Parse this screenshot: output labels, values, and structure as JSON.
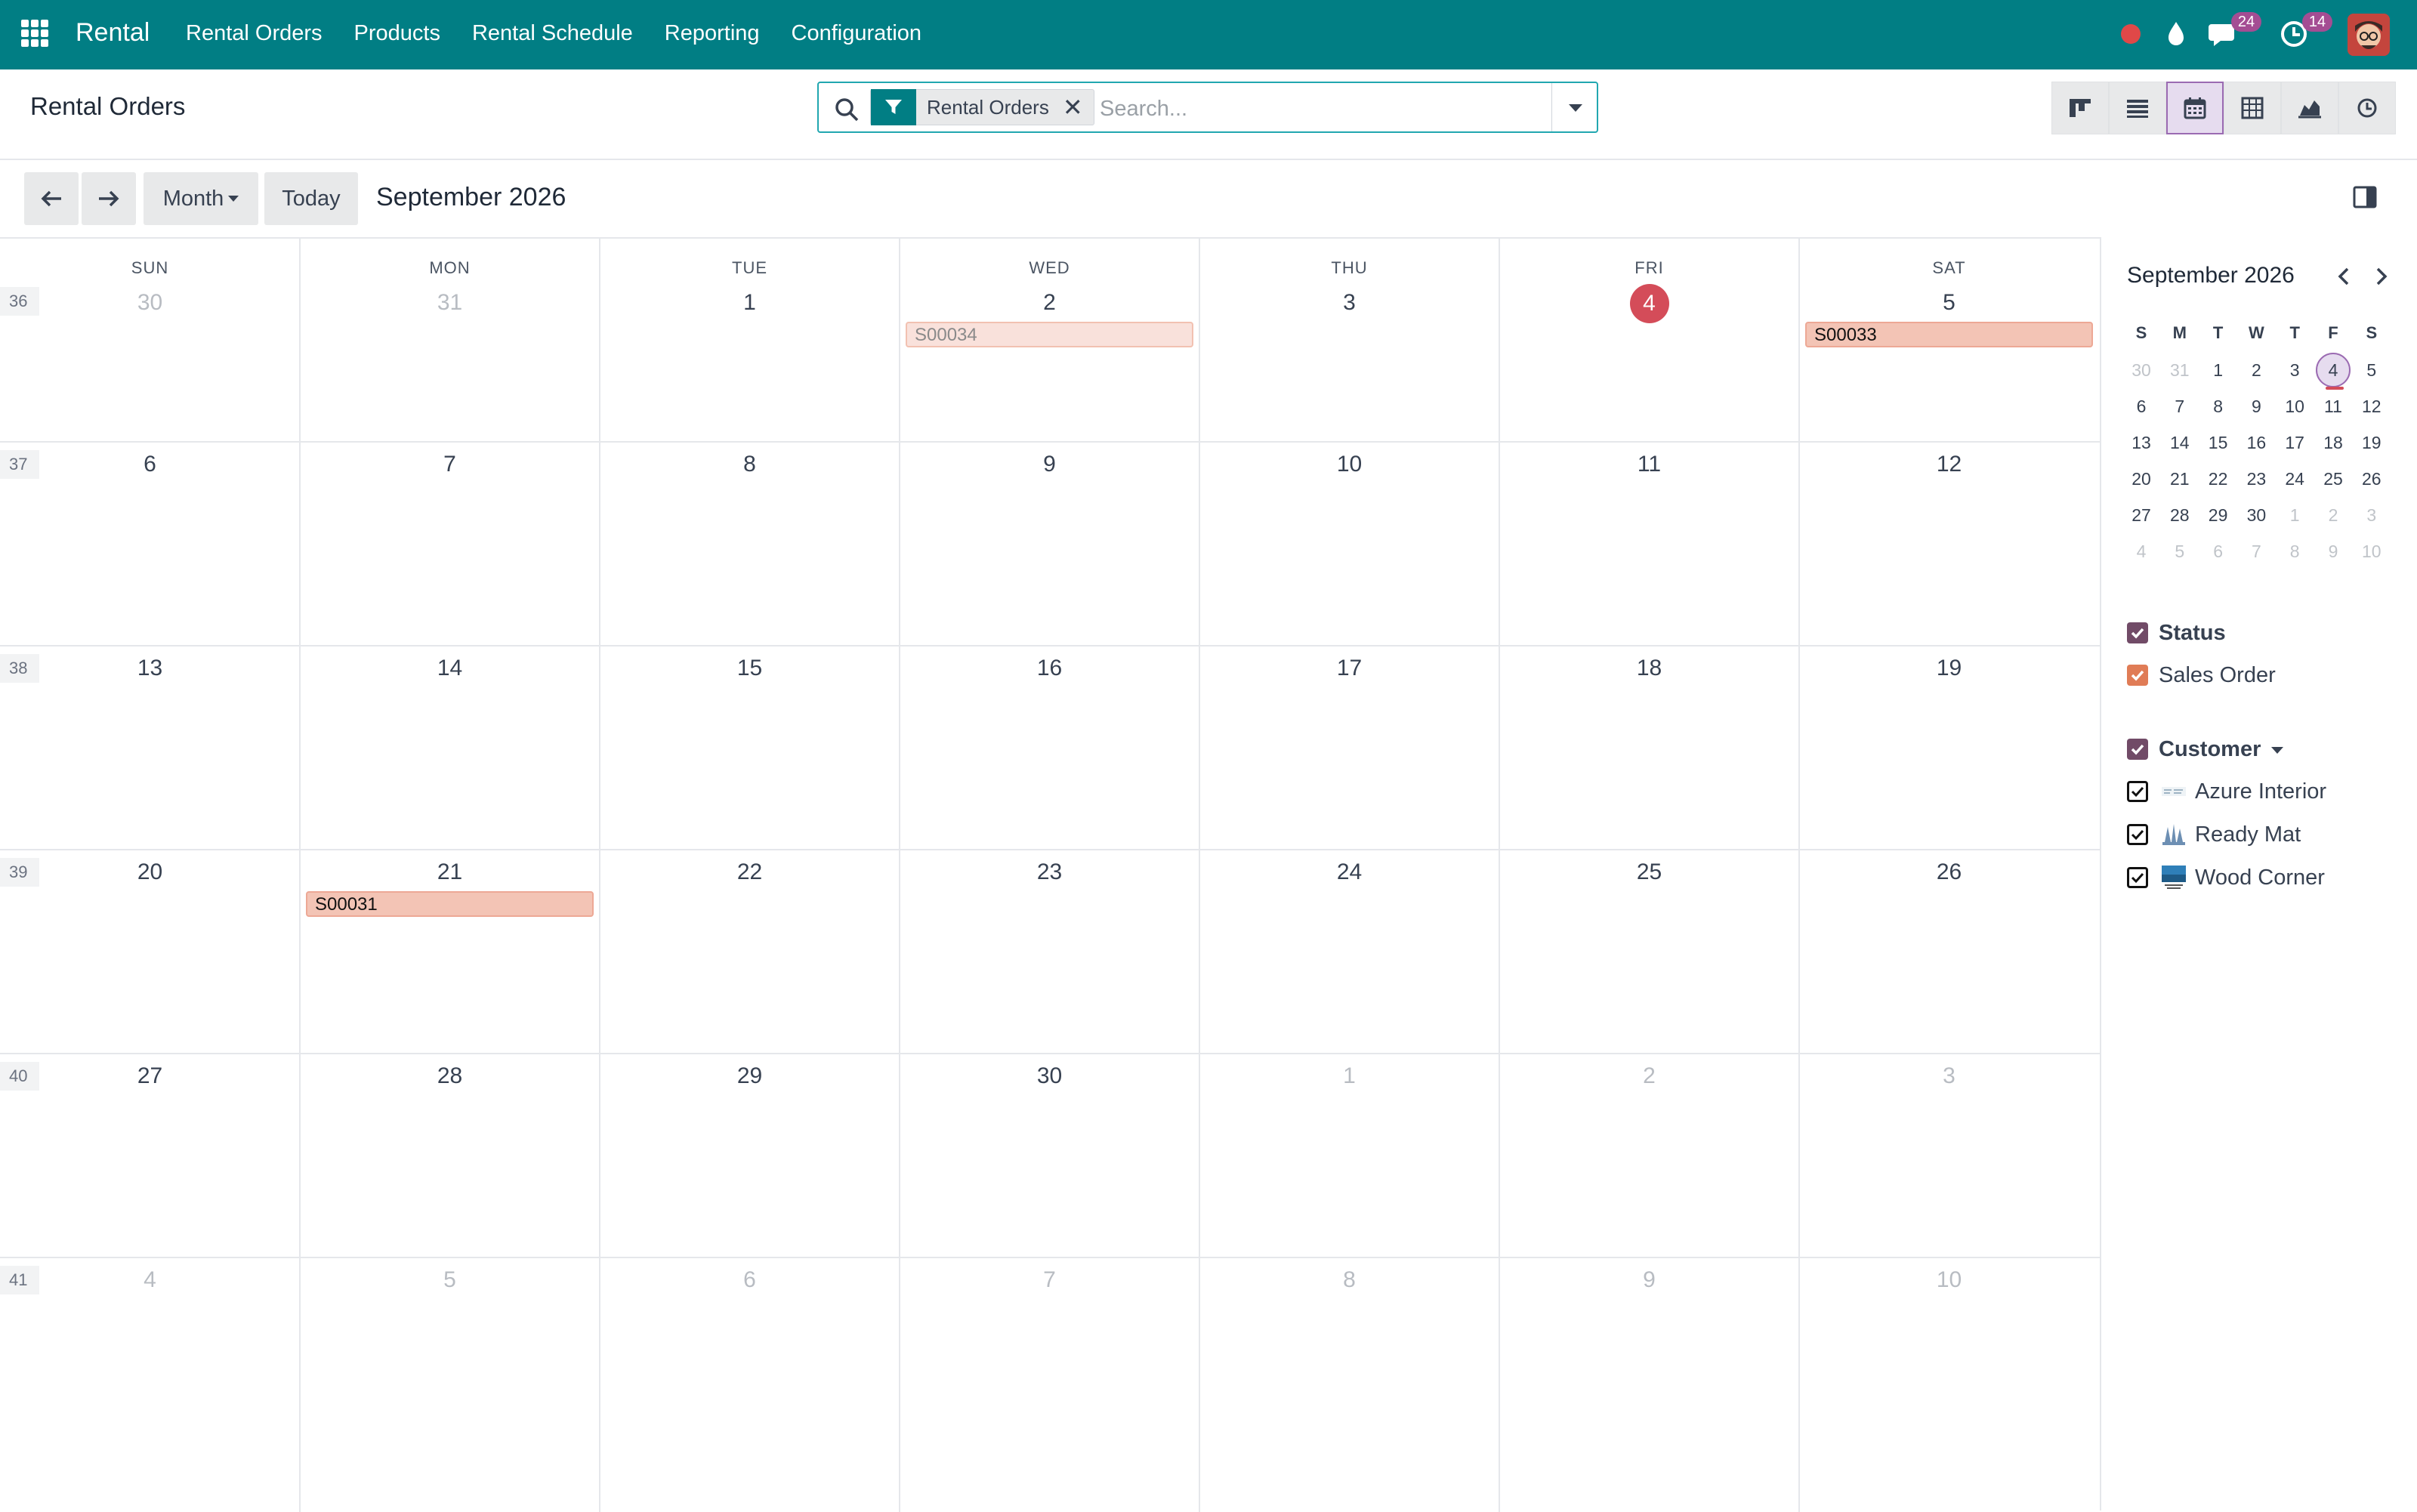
{
  "navbar": {
    "brand": "Rental",
    "menu": [
      "Rental Orders",
      "Products",
      "Rental Schedule",
      "Reporting",
      "Configuration"
    ],
    "messages_badge": "24",
    "activities_badge": "14",
    "icons": [
      "apps-grid-icon",
      "recording-dot-icon",
      "drop-icon",
      "chat-icon",
      "clock-icon",
      "user-avatar"
    ]
  },
  "control_panel": {
    "title": "Rental Orders",
    "search": {
      "facet_label": "Rental Orders",
      "placeholder": "Search..."
    },
    "views": [
      "kanban",
      "list",
      "calendar",
      "pivot",
      "graph",
      "activity"
    ],
    "active_view": "calendar"
  },
  "toolbar": {
    "scale": "Month",
    "today": "Today",
    "range_title": "September 2026"
  },
  "calendar": {
    "weekday_headers": [
      "SUN",
      "MON",
      "TUE",
      "WED",
      "THU",
      "FRI",
      "SAT"
    ],
    "weeks": [
      {
        "num": "36",
        "days": [
          "30",
          "31",
          "1",
          "2",
          "3",
          "4",
          "5"
        ],
        "other": [
          true,
          true,
          false,
          false,
          false,
          false,
          false
        ]
      },
      {
        "num": "37",
        "days": [
          "6",
          "7",
          "8",
          "9",
          "10",
          "11",
          "12"
        ],
        "other": [
          false,
          false,
          false,
          false,
          false,
          false,
          false
        ]
      },
      {
        "num": "38",
        "days": [
          "13",
          "14",
          "15",
          "16",
          "17",
          "18",
          "19"
        ],
        "other": [
          false,
          false,
          false,
          false,
          false,
          false,
          false
        ]
      },
      {
        "num": "39",
        "days": [
          "20",
          "21",
          "22",
          "23",
          "24",
          "25",
          "26"
        ],
        "other": [
          false,
          false,
          false,
          false,
          false,
          false,
          false
        ]
      },
      {
        "num": "40",
        "days": [
          "27",
          "28",
          "29",
          "30",
          "1",
          "2",
          "3"
        ],
        "other": [
          false,
          false,
          false,
          false,
          true,
          true,
          true
        ]
      },
      {
        "num": "41",
        "days": [
          "4",
          "5",
          "6",
          "7",
          "8",
          "9",
          "10"
        ],
        "other": [
          true,
          true,
          true,
          true,
          true,
          true,
          true
        ]
      }
    ],
    "today": {
      "week": 0,
      "day": 5
    },
    "events": [
      {
        "label": "S00034",
        "week": 0,
        "day": 3,
        "style": "light"
      },
      {
        "label": "S00033",
        "week": 0,
        "day": 6,
        "style": "solid"
      },
      {
        "label": "S00031",
        "week": 3,
        "day": 1,
        "style": "solid"
      }
    ]
  },
  "side_panel": {
    "mini_title": "September 2026",
    "mini_headers": [
      "S",
      "M",
      "T",
      "W",
      "T",
      "F",
      "S"
    ],
    "mini_weeks": [
      {
        "days": [
          "30",
          "31",
          "1",
          "2",
          "3",
          "4",
          "5"
        ],
        "other": [
          true,
          true,
          false,
          false,
          false,
          false,
          false
        ]
      },
      {
        "days": [
          "6",
          "7",
          "8",
          "9",
          "10",
          "11",
          "12"
        ],
        "other": [
          false,
          false,
          false,
          false,
          false,
          false,
          false
        ]
      },
      {
        "days": [
          "13",
          "14",
          "15",
          "16",
          "17",
          "18",
          "19"
        ],
        "other": [
          false,
          false,
          false,
          false,
          false,
          false,
          false
        ]
      },
      {
        "days": [
          "20",
          "21",
          "22",
          "23",
          "24",
          "25",
          "26"
        ],
        "other": [
          false,
          false,
          false,
          false,
          false,
          false,
          false
        ]
      },
      {
        "days": [
          "27",
          "28",
          "29",
          "30",
          "1",
          "2",
          "3"
        ],
        "other": [
          false,
          false,
          false,
          false,
          true,
          true,
          true
        ]
      },
      {
        "days": [
          "4",
          "5",
          "6",
          "7",
          "8",
          "9",
          "10"
        ],
        "other": [
          true,
          true,
          true,
          true,
          true,
          true,
          true
        ]
      }
    ],
    "mini_today": {
      "week": 0,
      "day": 5
    },
    "status": {
      "title": "Status",
      "items": [
        {
          "label": "Sales Order",
          "color": "#e07c56"
        }
      ]
    },
    "customer": {
      "title": "Customer",
      "items": [
        {
          "label": "Azure Interior"
        },
        {
          "label": "Ready Mat"
        },
        {
          "label": "Wood Corner"
        }
      ]
    }
  },
  "colors": {
    "navbar": "#017e84",
    "accent": "#9b6bb2",
    "today": "#d44c59",
    "filter_checkbox": "#714b67",
    "status_checkbox": "#e07c56"
  }
}
